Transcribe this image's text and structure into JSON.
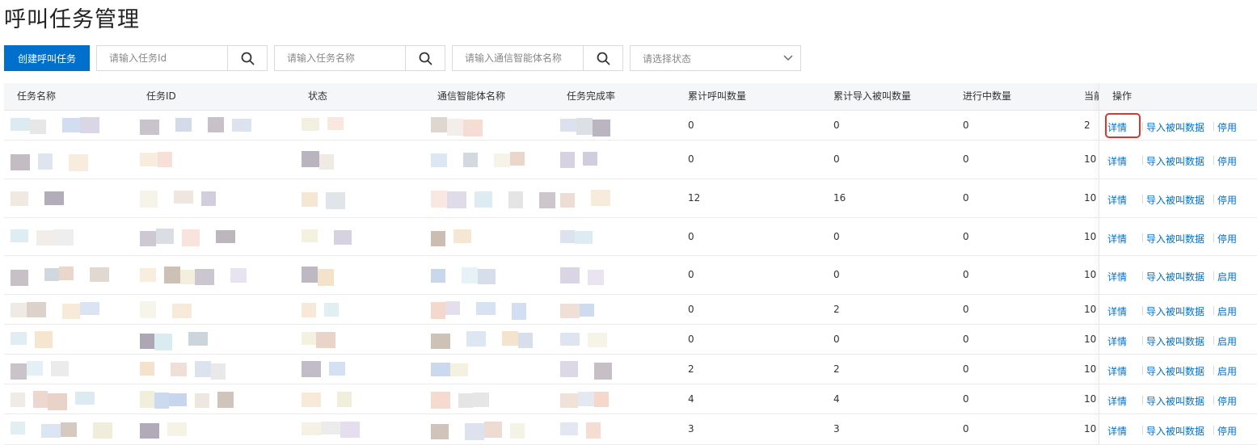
{
  "page_title": "呼叫任务管理",
  "toolbar": {
    "create_label": "创建呼叫任务",
    "search_id_placeholder": "请输入任务Id",
    "search_name_placeholder": "请输入任务名称",
    "search_agent_placeholder": "请输入通信智能体名称",
    "status_placeholder": "请选择状态"
  },
  "table": {
    "headers": [
      "任务名称",
      "任务ID",
      "状态",
      "通信智能体名称",
      "任务完成率",
      "累计呼叫数量",
      "累计导入被叫数量",
      "进行中数量",
      "当前"
    ],
    "ops_header": "操作",
    "rows": [
      {
        "calls": "0",
        "imported": "0",
        "in_progress": "0",
        "current": "2",
        "ops": [
          "详情",
          "导入被叫数据",
          "停用"
        ]
      },
      {
        "calls": "0",
        "imported": "0",
        "in_progress": "0",
        "current": "10",
        "ops": [
          "详情",
          "导入被叫数据",
          "停用"
        ]
      },
      {
        "calls": "12",
        "imported": "16",
        "in_progress": "0",
        "current": "10",
        "ops": [
          "详情",
          "导入被叫数据",
          "停用"
        ]
      },
      {
        "calls": "0",
        "imported": "0",
        "in_progress": "0",
        "current": "10",
        "ops": [
          "详情",
          "导入被叫数据",
          "停用"
        ]
      },
      {
        "calls": "0",
        "imported": "0",
        "in_progress": "0",
        "current": "10",
        "ops": [
          "详情",
          "导入被叫数据",
          "启用"
        ]
      },
      {
        "calls": "0",
        "imported": "2",
        "in_progress": "0",
        "current": "10",
        "ops": [
          "详情",
          "导入被叫数据",
          "启用"
        ]
      },
      {
        "calls": "0",
        "imported": "0",
        "in_progress": "0",
        "current": "10",
        "ops": [
          "详情",
          "导入被叫数据",
          "启用"
        ]
      },
      {
        "calls": "2",
        "imported": "2",
        "in_progress": "0",
        "current": "10",
        "ops": [
          "详情",
          "导入被叫数据",
          "启用"
        ]
      },
      {
        "calls": "4",
        "imported": "4",
        "in_progress": "0",
        "current": "10",
        "ops": [
          "详情",
          "导入被叫数据",
          "停用"
        ]
      },
      {
        "calls": "3",
        "imported": "3",
        "in_progress": "0",
        "current": "10",
        "ops": [
          "详情",
          "导入被叫数据",
          "停用"
        ]
      }
    ]
  },
  "colors": {
    "primary": "#0070cc",
    "highlight": "#d9372b",
    "link": "#0070cc"
  },
  "icons": [
    "search-icon",
    "chevron-down-icon"
  ]
}
